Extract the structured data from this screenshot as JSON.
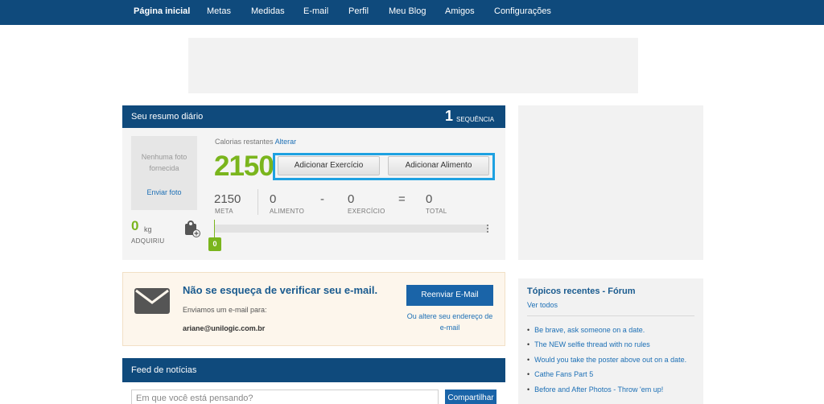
{
  "nav": {
    "items": [
      "Página inicial",
      "Metas",
      "Medidas",
      "E-mail",
      "Perfil",
      "Meu Blog",
      "Amigos",
      "Configurações"
    ]
  },
  "summary": {
    "title": "Seu resumo diário",
    "streak_count": "1",
    "streak_label": "SEQUÊNCIA",
    "no_photo": "Nenhuma foto fornecida",
    "send_photo": "Enviar foto",
    "gain_value": "0",
    "gain_unit": "kg",
    "gain_label": "ADQUIRIU",
    "remaining_label": "Calorias restantes",
    "change_link": "Alterar",
    "remaining_value": "2150",
    "add_exercise": "Adicionar Exercício",
    "add_food": "Adicionar Alimento",
    "goal_value": "2150",
    "goal_label": "META",
    "minus": "-",
    "equals": "=",
    "food_value": "0",
    "food_label": "ALIMENTO",
    "exercise_value": "0",
    "exercise_label": "EXERCÍCIO",
    "total_value": "0",
    "total_label": "TOTAL",
    "progress_badge": "0",
    "progress_fraction": 0
  },
  "notice": {
    "title": "Não se esqueça de verificar seu e-mail.",
    "sent_text": "Enviamos um e-mail para:",
    "email": "ariane@unilogic.com.br",
    "resend_button": "Reenviar E-Mail",
    "change_email": "Ou altere seu endereço de e-mail"
  },
  "forum": {
    "title": "Tópicos recentes - Fórum",
    "see_all": "Ver todos",
    "topics": [
      "Be brave, ask someone on a date.",
      "The NEW selfie thread with no rules",
      "Would you take the poster above out on a date.",
      "Cathe Fans Part 5",
      "Before and After Photos - Throw 'em up!"
    ]
  },
  "feed": {
    "title": "Feed de notícias",
    "placeholder": "Em que você está pensando?",
    "share_button": "Compartilhar"
  },
  "colors": {
    "nav_bg": "#0f4a7c",
    "accent_green": "#7ab51d",
    "link_blue": "#1c6fb5",
    "highlight": "#1ea1e1"
  }
}
